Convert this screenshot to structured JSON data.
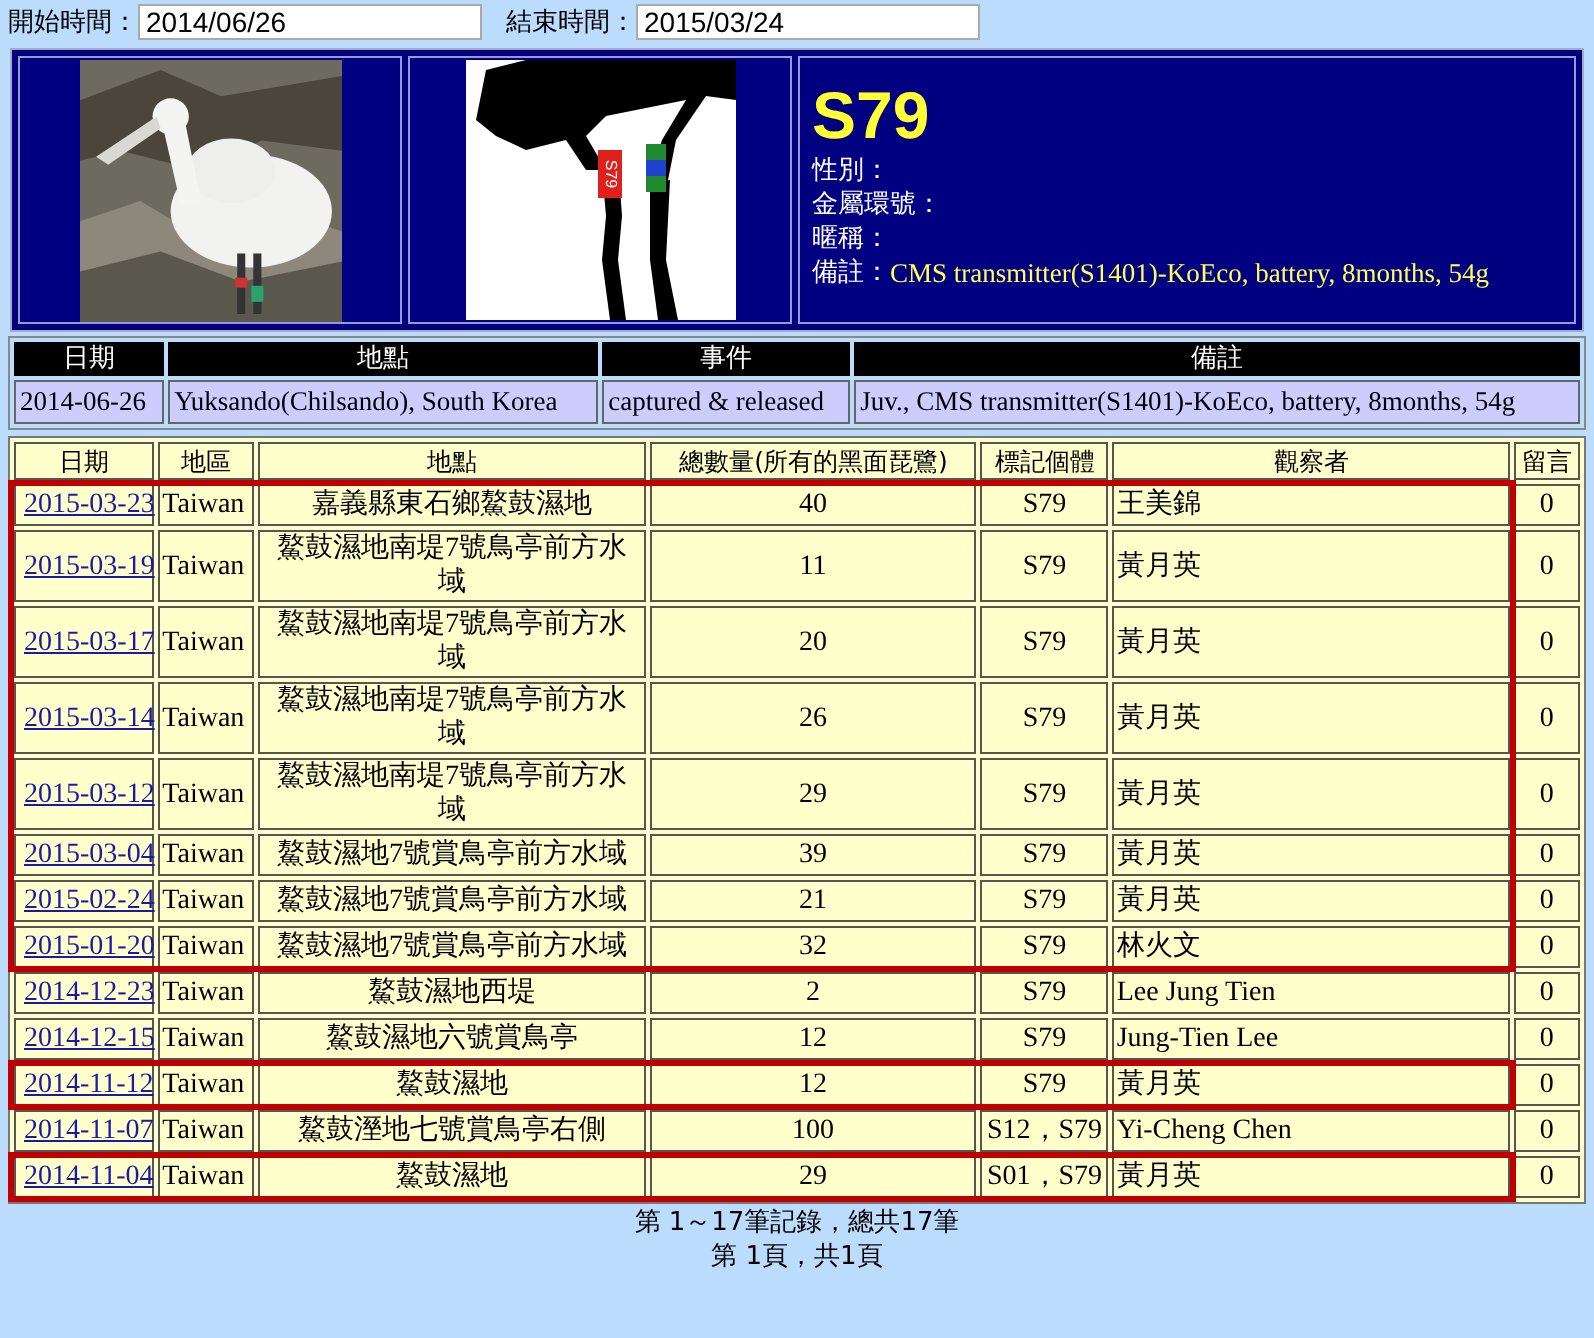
{
  "filters": [
    {
      "label": "開始時間：",
      "value": "2014/06/26"
    },
    {
      "label": "結束時間：",
      "value": "2015/03/24"
    }
  ],
  "bird": {
    "code": "S79",
    "band_label": "S79",
    "fields": [
      {
        "label": "性別："
      },
      {
        "label": "金屬環號："
      },
      {
        "label": "暱稱："
      },
      {
        "label": "備註：",
        "value": "CMS transmitter(S1401)-KoEco, battery, 8months, 54g"
      }
    ]
  },
  "events": {
    "columns": [
      "日期",
      "地點",
      "事件",
      "備註"
    ],
    "rows": [
      [
        "2014-06-26",
        "Yuksando(Chilsando), South Korea",
        "captured & released",
        "Juv., CMS transmitter(S1401)-KoEco, battery, 8months, 54g"
      ]
    ]
  },
  "observations": {
    "columns": [
      "日期",
      "地區",
      "地點",
      "總數量(所有的黑面琵鷺)",
      "標記個體",
      "觀察者",
      "留言"
    ],
    "rows": [
      {
        "date": "2015-03-23",
        "region": "Taiwan",
        "place": "嘉義縣東石鄉鰲鼓濕地",
        "count": "40",
        "tags": "S79",
        "observer": "王美錦",
        "comments": "0",
        "highlighted": true
      },
      {
        "date": "2015-03-19",
        "region": "Taiwan",
        "place": "鰲鼓濕地南堤7號鳥亭前方水域",
        "count": "11",
        "tags": "S79",
        "observer": "黃月英",
        "comments": "0",
        "highlighted": true
      },
      {
        "date": "2015-03-17",
        "region": "Taiwan",
        "place": "鰲鼓濕地南堤7號鳥亭前方水域",
        "count": "20",
        "tags": "S79",
        "observer": "黃月英",
        "comments": "0",
        "highlighted": true
      },
      {
        "date": "2015-03-14",
        "region": "Taiwan",
        "place": "鰲鼓濕地南堤7號鳥亭前方水域",
        "count": "26",
        "tags": "S79",
        "observer": "黃月英",
        "comments": "0",
        "highlighted": true
      },
      {
        "date": "2015-03-12",
        "region": "Taiwan",
        "place": "鰲鼓濕地南堤7號鳥亭前方水域",
        "count": "29",
        "tags": "S79",
        "observer": "黃月英",
        "comments": "0",
        "highlighted": true
      },
      {
        "date": "2015-03-04",
        "region": "Taiwan",
        "place": "鰲鼓濕地7號賞鳥亭前方水域",
        "count": "39",
        "tags": "S79",
        "observer": "黃月英",
        "comments": "0",
        "highlighted": true
      },
      {
        "date": "2015-02-24",
        "region": "Taiwan",
        "place": "鰲鼓濕地7號賞鳥亭前方水域",
        "count": "21",
        "tags": "S79",
        "observer": "黃月英",
        "comments": "0",
        "highlighted": true
      },
      {
        "date": "2015-01-20",
        "region": "Taiwan",
        "place": "鰲鼓濕地7號賞鳥亭前方水域",
        "count": "32",
        "tags": "S79",
        "observer": "林火文",
        "comments": "0",
        "highlighted": true
      },
      {
        "date": "2014-12-23",
        "region": "Taiwan",
        "place": "鰲鼓濕地西堤",
        "count": "2",
        "tags": "S79",
        "observer": "Lee Jung Tien",
        "comments": "0",
        "highlighted": false
      },
      {
        "date": "2014-12-15",
        "region": "Taiwan",
        "place": "鰲鼓濕地六號賞鳥亭",
        "count": "12",
        "tags": "S79",
        "observer": "Jung-Tien Lee",
        "comments": "0",
        "highlighted": false
      },
      {
        "date": "2014-11-12",
        "region": "Taiwan",
        "place": "鰲鼓濕地",
        "count": "12",
        "tags": "S79",
        "observer": "黃月英",
        "comments": "0",
        "highlighted": true
      },
      {
        "date": "2014-11-07",
        "region": "Taiwan",
        "place": "鰲鼓溼地七號賞鳥亭右側",
        "count": "100",
        "tags": "S12，S79",
        "observer": "Yi-Cheng Chen",
        "comments": "0",
        "highlighted": false
      },
      {
        "date": "2014-11-04",
        "region": "Taiwan",
        "place": "鰲鼓濕地",
        "count": "29",
        "tags": "S01，S79",
        "observer": "黃月英",
        "comments": "0",
        "highlighted": true
      }
    ]
  },
  "footer": [
    "第 1～17筆記錄，總共17筆",
    "第 1頁，共1頁"
  ]
}
